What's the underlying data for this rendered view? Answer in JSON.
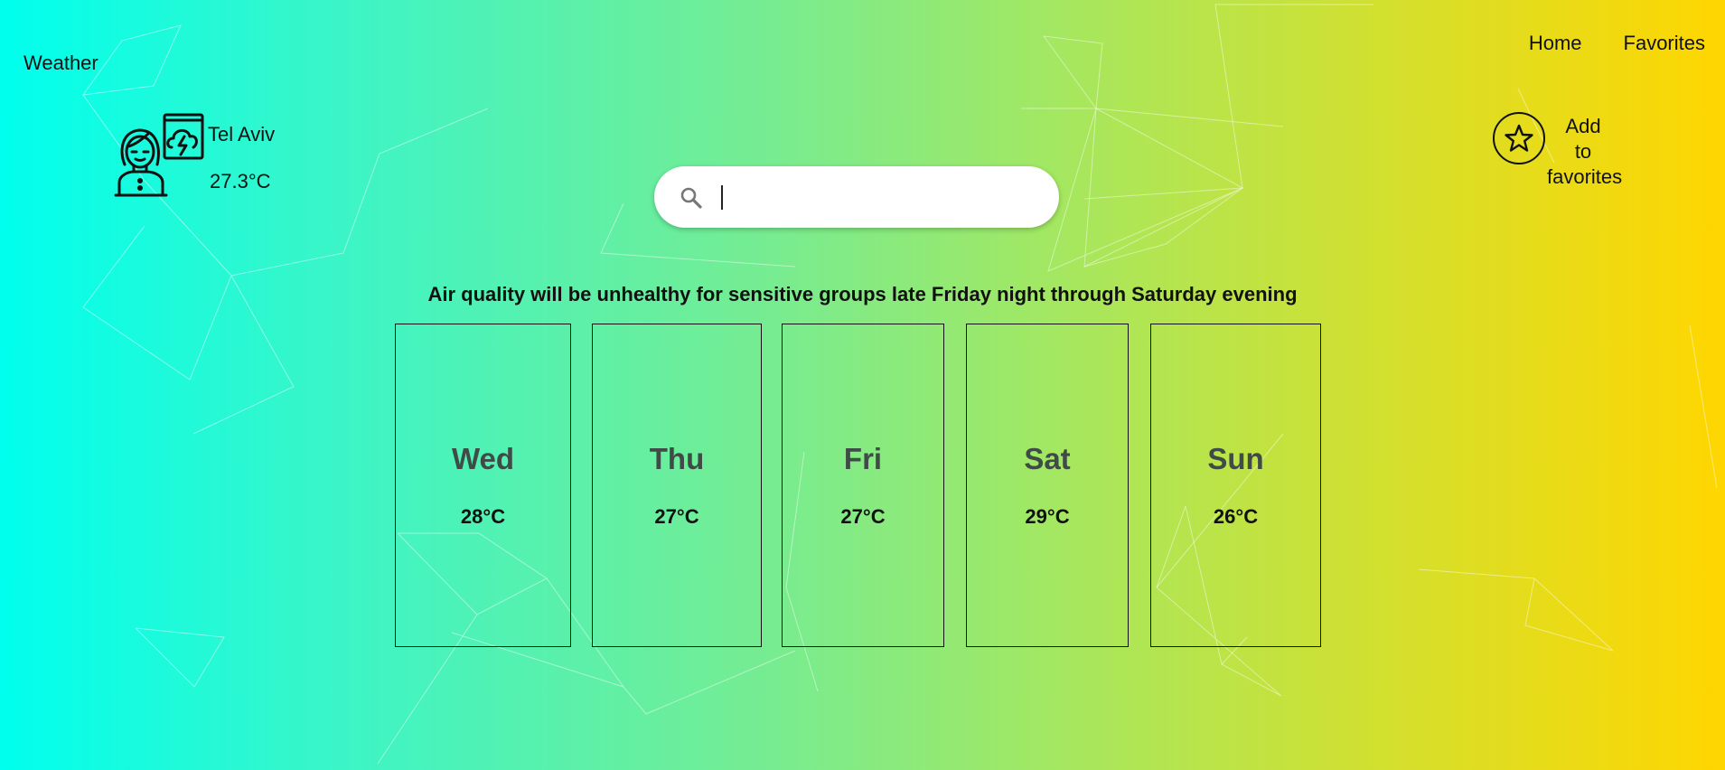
{
  "header": {
    "brand": "Weather",
    "nav": [
      {
        "label": "Home"
      },
      {
        "label": "Favorites"
      }
    ]
  },
  "current": {
    "city": "Tel Aviv",
    "temperature": "27.3°C",
    "icons": [
      "person-avatar-icon",
      "thunderstorm-icon"
    ]
  },
  "favorites": {
    "label_lines": [
      "Add",
      "to",
      "favorites"
    ],
    "icon": "star-icon"
  },
  "search": {
    "icon": "search-icon",
    "value": "",
    "placeholder": ""
  },
  "headline": "Air quality will be unhealthy for sensitive groups late Friday night through Saturday evening",
  "forecast": [
    {
      "day": "Wed",
      "temp": "28°C"
    },
    {
      "day": "Thu",
      "temp": "27°C"
    },
    {
      "day": "Fri",
      "temp": "27°C"
    },
    {
      "day": "Sat",
      "temp": "29°C"
    },
    {
      "day": "Sun",
      "temp": "26°C"
    }
  ],
  "colors": {
    "gradient_start": "#00ffee",
    "gradient_end": "#ffd600",
    "text": "#111111",
    "day_name": "#3f4b46"
  }
}
